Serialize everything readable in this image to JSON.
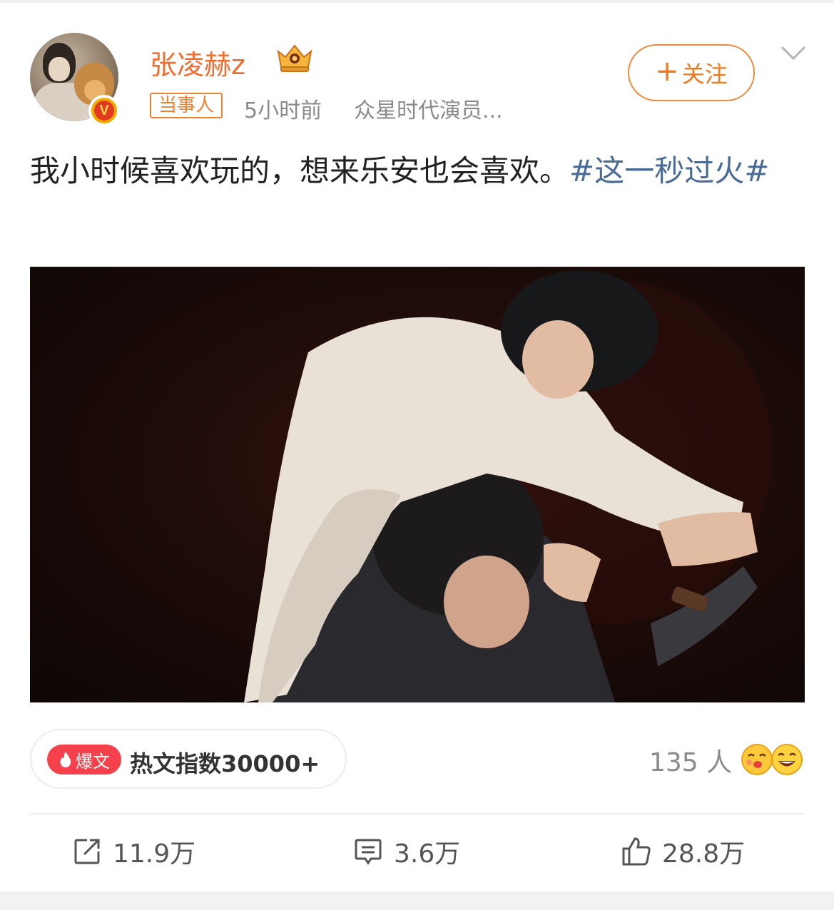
{
  "post": {
    "author": {
      "name": "张凌赫z",
      "avatar_icon": "avatar-photo",
      "verified_icon": "verified-badge-icon",
      "verified_mark": "V",
      "crown_icon": "vip-crown-icon"
    },
    "tag": "当事人",
    "time": "5小时前",
    "source": "众星时代演员...",
    "follow_label": "关注",
    "text": {
      "body": "我小时候喜欢玩的，想来乐安也会喜欢。",
      "hashtag": "#这一秒过火#"
    },
    "media": {
      "type": "video-still",
      "icon": "video-frame"
    },
    "hot": {
      "badge_label": "爆文",
      "label": "热文指数30000+"
    },
    "reactions": {
      "count_label": "135 人"
    },
    "actions": {
      "share": "11.9万",
      "comment": "3.6万",
      "like": "28.8万"
    }
  },
  "colors": {
    "accent_orange": "#f26c2e",
    "hashtag_blue": "#4a6b96",
    "hot_red": "#f4414b",
    "meta_gray": "#8a8a8a"
  }
}
